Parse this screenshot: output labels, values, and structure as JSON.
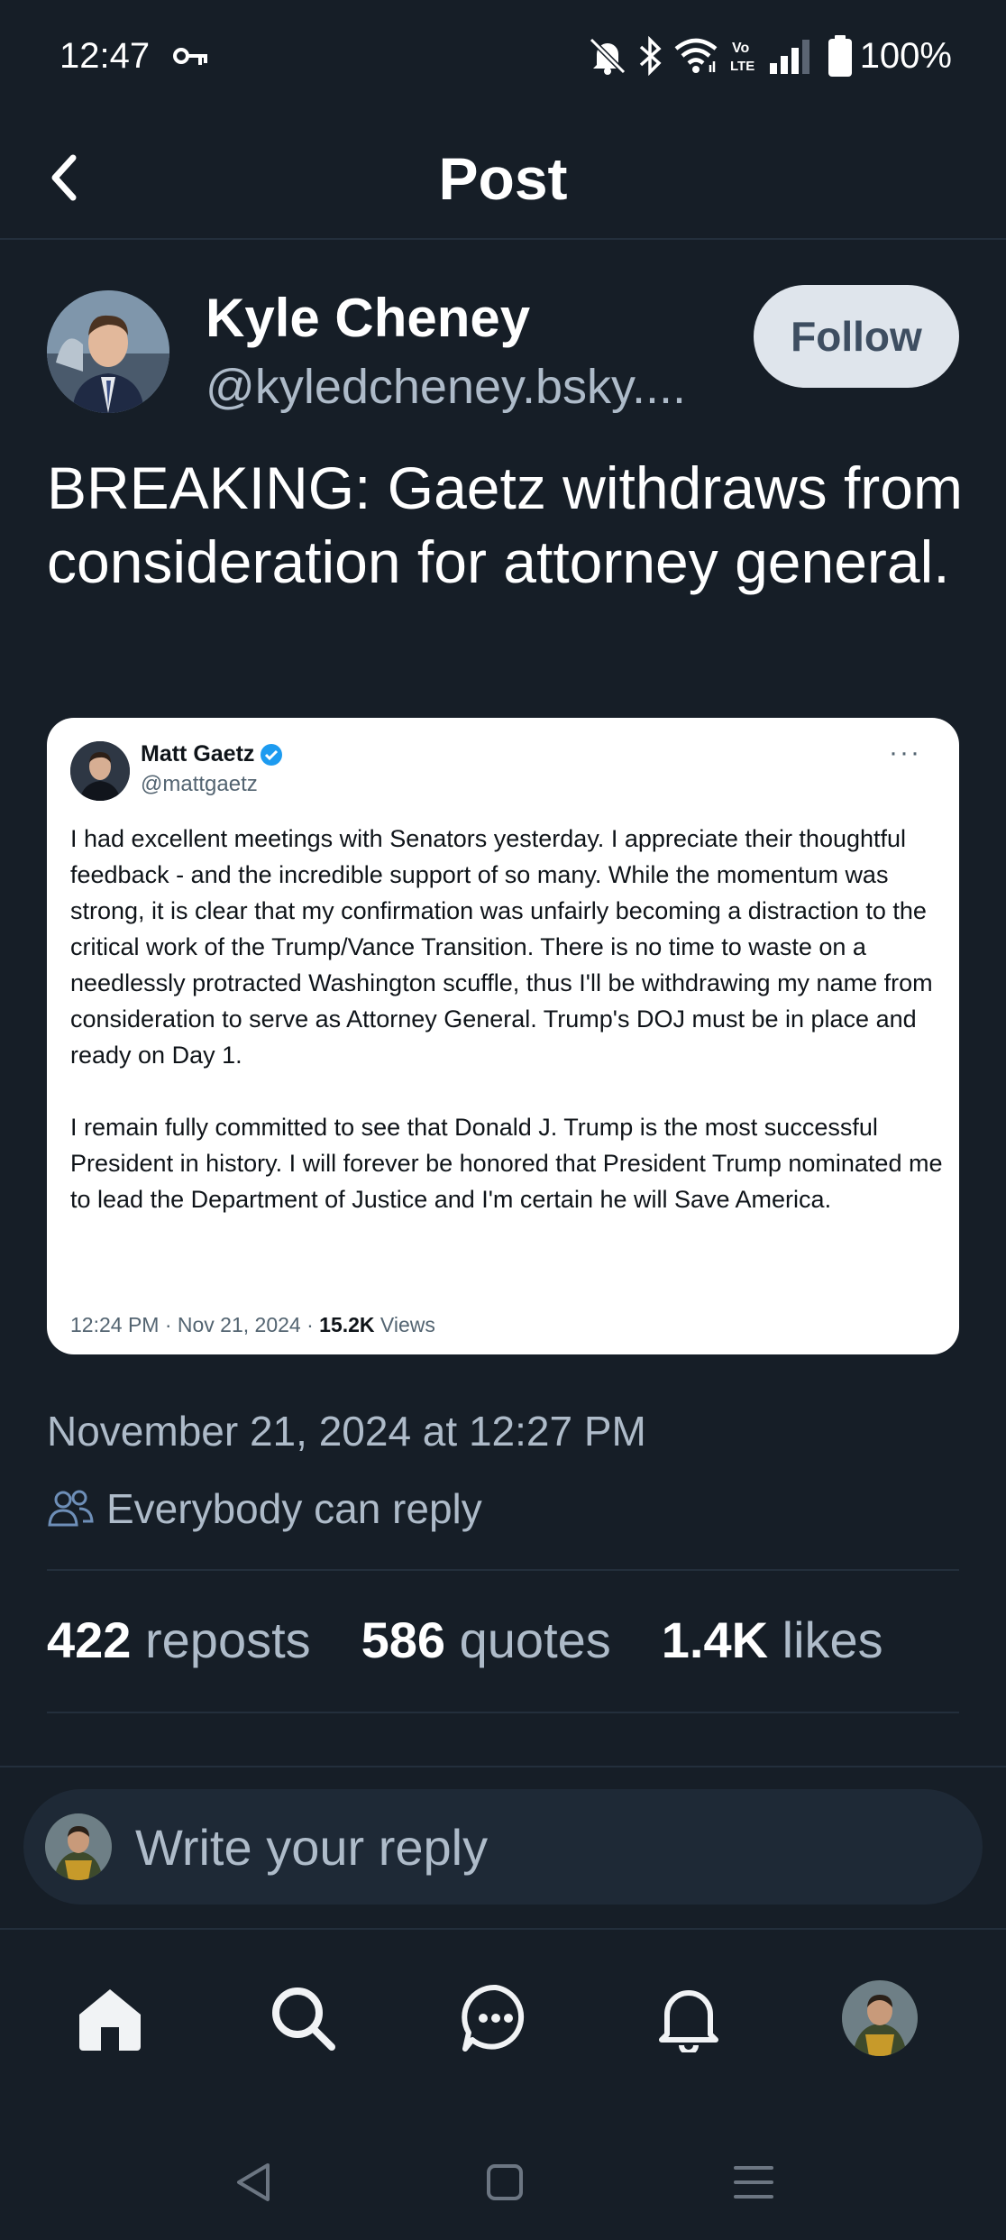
{
  "status_bar": {
    "time": "12:47",
    "battery": "100%",
    "icons": [
      "key-icon",
      "mute-icon",
      "bluetooth-icon",
      "wifi-icon",
      "volte-icon",
      "signal-icon",
      "battery-icon"
    ]
  },
  "header": {
    "title": "Post",
    "back_icon": "chevron-left-icon"
  },
  "post": {
    "author_name": "Kyle Cheney",
    "author_handle": "@kyledcheney.bsky....",
    "follow_label": "Follow",
    "text": "BREAKING: Gaetz withdraws from consideration for attorney general.",
    "date": "November 21, 2024 at 12:27 PM",
    "reply_permission": "Everybody can reply",
    "stats": {
      "reposts_count": "422",
      "reposts_label": "reposts",
      "quotes_count": "586",
      "quotes_label": "quotes",
      "likes_count": "1.4K",
      "likes_label": "likes"
    }
  },
  "embed": {
    "name": "Matt Gaetz",
    "handle": "@mattgaetz",
    "more": "···",
    "paragraph1": "I had excellent meetings with Senators yesterday.  I appreciate their thoughtful feedback - and the incredible support of so many.  While the momentum was strong, it is clear that my confirmation was unfairly becoming a distraction to the critical work of the Trump/Vance Transition.  There is no time to waste on a needlessly protracted Washington scuffle, thus I'll be withdrawing my name from consideration to serve as Attorney General.  Trump's DOJ must be in place and ready on Day 1.",
    "paragraph2": "I remain fully committed to see that Donald J. Trump is the most successful President in history.  I will forever be honored that President Trump nominated me to lead the Department of Justice and I'm certain he will Save America.",
    "meta_time": "12:24 PM · Nov 21, 2024 · ",
    "views_count": "15.2K",
    "views_label": " Views"
  },
  "reply": {
    "placeholder": "Write your reply"
  },
  "bottom_nav": [
    "home-icon",
    "search-icon",
    "chat-icon",
    "bell-icon",
    "profile-avatar"
  ],
  "colors": {
    "background": "#161e27",
    "divider": "#232f3c",
    "muted_text": "#aebbc9",
    "accent": "#1d9bf0",
    "follow_bg": "#dfe5ec"
  }
}
